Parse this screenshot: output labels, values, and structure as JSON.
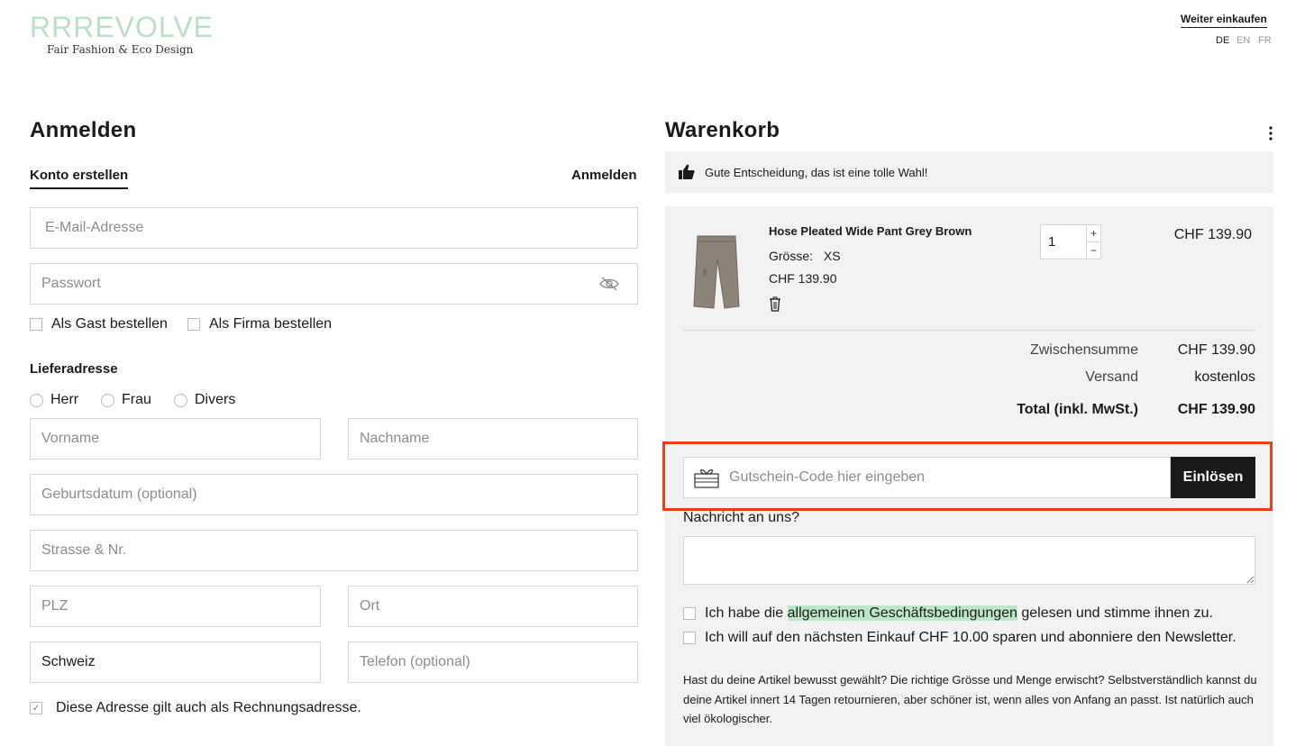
{
  "brand": {
    "logo_text": "RRREVOLVE",
    "tagline": "Fair Fashion & Eco Design"
  },
  "header": {
    "continue_shopping": "Weiter einkaufen",
    "languages": [
      {
        "code": "DE",
        "active": true
      },
      {
        "code": "EN",
        "active": false
      },
      {
        "code": "FR",
        "active": false
      }
    ]
  },
  "login": {
    "title": "Anmelden",
    "tab_create": "Konto erstellen",
    "tab_login": "Anmelden",
    "email_placeholder": "E-Mail-Adresse",
    "password_placeholder": "Passwort",
    "guest_checkbox": "Als Gast bestellen",
    "company_checkbox": "Als Firma bestellen",
    "delivery_title": "Lieferadresse",
    "salutations": [
      "Herr",
      "Frau",
      "Divers"
    ],
    "firstname_placeholder": "Vorname",
    "lastname_placeholder": "Nachname",
    "birthdate_placeholder": "Geburtsdatum (optional)",
    "street_placeholder": "Strasse & Nr.",
    "zip_placeholder": "PLZ",
    "city_placeholder": "Ort",
    "country_value": "Schweiz",
    "phone_placeholder": "Telefon (optional)",
    "billing_same": "Diese Adresse gilt auch als Rechnungsadresse.",
    "billing_same_checked": true
  },
  "cart": {
    "title": "Warenkorb",
    "banner": "Gute Entscheidung, das ist eine tolle Wahl!",
    "item": {
      "name": "Hose Pleated Wide Pant Grey Brown",
      "size_label": "Grösse:",
      "size_value": "XS",
      "unit_price": "CHF 139.90",
      "quantity": "1",
      "line_total": "CHF 139.90"
    },
    "subtotal_label": "Zwischensumme",
    "subtotal_value": "CHF 139.90",
    "shipping_label": "Versand",
    "shipping_value": "kostenlos",
    "total_label": "Total (inkl. MwSt.)",
    "total_value": "CHF 139.90",
    "coupon_placeholder": "Gutschein-Code hier eingeben",
    "coupon_button": "Einlösen",
    "message_label": "Nachricht an uns?",
    "terms_prefix": "Ich habe die ",
    "terms_link": "allgemeinen Geschäftsbedingungen",
    "terms_suffix": " gelesen und stimme ihnen zu.",
    "newsletter": "Ich will auf den nächsten Einkauf CHF 10.00 sparen und abonniere den Newsletter.",
    "note": "Hast du deine Artikel bewusst gewählt? Die richtige Grösse und Menge erwischt? Selbstverständlich kannst du deine Artikel innert 14 Tagen retournieren, aber schöner ist, wenn alles von Anfang an passt. Ist natürlich auch viel ökologischer."
  },
  "colors": {
    "accent_green": "#bde8c8",
    "highlight_border": "#e8411a",
    "panel_bg": "#f2f2f2",
    "button_dark": "#1a1a1a"
  }
}
